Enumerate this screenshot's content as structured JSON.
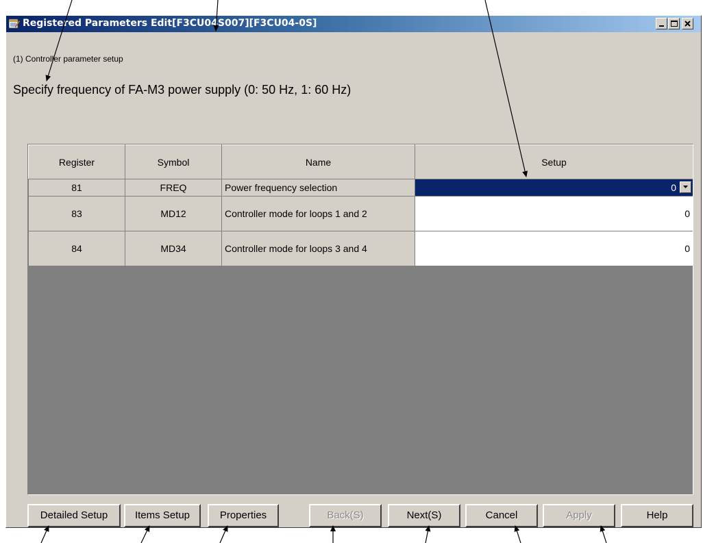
{
  "window": {
    "title": "Registered Parameters Edit[F3CU04S007][F3CU04-0S]",
    "caption_buttons": [
      "minimize-icon",
      "maximize-icon",
      "close-icon"
    ]
  },
  "section_label": "(1) Controller parameter setup",
  "description": "Specify frequency of FA-M3 power supply (0: 50 Hz, 1: 60 Hz)",
  "table": {
    "columns": [
      "Register",
      "Symbol",
      "Name",
      "Setup"
    ],
    "rows": [
      {
        "register": "81",
        "symbol": "FREQ",
        "name": "Power frequency selection",
        "setup": "0",
        "selected": true
      },
      {
        "register": "83",
        "symbol": "MD12",
        "name": "Controller mode for loops 1 and 2",
        "setup": "0",
        "selected": false
      },
      {
        "register": "84",
        "symbol": "MD34",
        "name": "Controller mode for loops 3 and 4",
        "setup": "0",
        "selected": false
      }
    ]
  },
  "buttons": {
    "detailed_setup": "Detailed Setup",
    "items_setup": "Items Setup",
    "properties": "Properties",
    "back": "Back(S)",
    "next": "Next(S)",
    "cancel": "Cancel",
    "apply": "Apply",
    "help": "Help"
  },
  "disabled_buttons": [
    "back",
    "apply"
  ],
  "colors": {
    "dialog_face": "#d4d0c8",
    "title_gradient_start": "#0a246a",
    "selection": "#0a246a",
    "grid_background": "#808080"
  }
}
